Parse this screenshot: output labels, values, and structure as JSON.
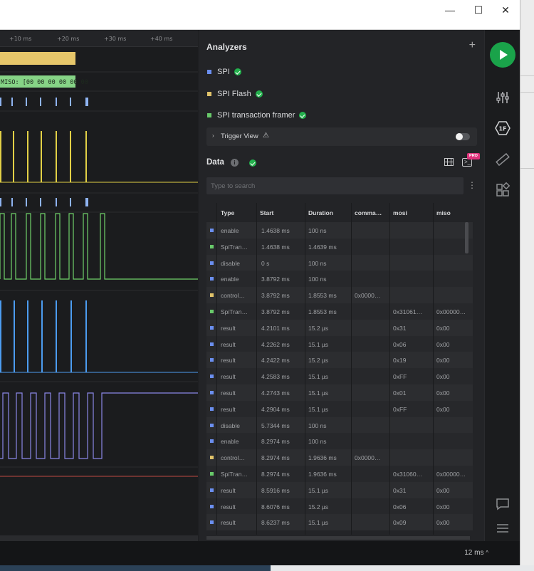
{
  "window": {
    "minimize_glyph": "—",
    "maximize_glyph": "☐",
    "close_glyph": "✕"
  },
  "timeline": {
    "ticks": [
      "+10 ms",
      "+20 ms",
      "+30 ms",
      "+40 ms"
    ]
  },
  "waveform": {
    "spi_decode_label": "MISO: [00 00 00 00 00 00",
    "channel_colors": [
      "#e6c66a",
      "#8fb4f2",
      "#e2d046",
      "#71d16a",
      "#4c9cf0",
      "#8a87e6",
      "#c24a43"
    ]
  },
  "analyzers": {
    "title": "Analyzers",
    "add_glyph": "+",
    "items": [
      {
        "label": "SPI",
        "color": "#6b8ff0"
      },
      {
        "label": "SPI Flash",
        "color": "#e0c36a"
      },
      {
        "label": "SPI transaction framer",
        "color": "#68c96a"
      }
    ],
    "trigger_view": {
      "label": "Trigger View",
      "warning_glyph": "⚠",
      "chevron": "›"
    }
  },
  "data_panel": {
    "title": "Data",
    "info_glyph": "i",
    "pro_badge": "PRO",
    "terminal_glyph": ">_",
    "search_placeholder": "Type to search",
    "menu_glyph": "⋮",
    "columns": [
      "Type",
      "Start",
      "Duration",
      "comma…",
      "mosi",
      "miso"
    ],
    "rows": [
      {
        "color": "#6b8ff0",
        "type": "enable",
        "start": "1.4638 ms",
        "duration": "100 ns",
        "command": "",
        "mosi": "",
        "miso": ""
      },
      {
        "color": "#68c96a",
        "type": "SpiTran…",
        "start": "1.4638 ms",
        "duration": "1.4639 ms",
        "command": "",
        "mosi": "",
        "miso": ""
      },
      {
        "color": "#6b8ff0",
        "type": "disable",
        "start": "0 s",
        "duration": "100 ns",
        "command": "",
        "mosi": "",
        "miso": ""
      },
      {
        "color": "#6b8ff0",
        "type": "enable",
        "start": "3.8792 ms",
        "duration": "100 ns",
        "command": "",
        "mosi": "",
        "miso": ""
      },
      {
        "color": "#e0c36a",
        "type": "control…",
        "start": "3.8792 ms",
        "duration": "1.8553 ms",
        "command": "0x0000…",
        "mosi": "",
        "miso": ""
      },
      {
        "color": "#68c96a",
        "type": "SpiTran…",
        "start": "3.8792 ms",
        "duration": "1.8553 ms",
        "command": "",
        "mosi": "0x31061…",
        "miso": "0x00000…"
      },
      {
        "color": "#6b8ff0",
        "type": "result",
        "start": "4.2101 ms",
        "duration": "15.2 µs",
        "command": "",
        "mosi": "0x31",
        "miso": "0x00"
      },
      {
        "color": "#6b8ff0",
        "type": "result",
        "start": "4.2262 ms",
        "duration": "15.1 µs",
        "command": "",
        "mosi": "0x06",
        "miso": "0x00"
      },
      {
        "color": "#6b8ff0",
        "type": "result",
        "start": "4.2422 ms",
        "duration": "15.2 µs",
        "command": "",
        "mosi": "0x19",
        "miso": "0x00"
      },
      {
        "color": "#6b8ff0",
        "type": "result",
        "start": "4.2583 ms",
        "duration": "15.1 µs",
        "command": "",
        "mosi": "0xFF",
        "miso": "0x00"
      },
      {
        "color": "#6b8ff0",
        "type": "result",
        "start": "4.2743 ms",
        "duration": "15.1 µs",
        "command": "",
        "mosi": "0x01",
        "miso": "0x00"
      },
      {
        "color": "#6b8ff0",
        "type": "result",
        "start": "4.2904 ms",
        "duration": "15.1 µs",
        "command": "",
        "mosi": "0xFF",
        "miso": "0x00"
      },
      {
        "color": "#6b8ff0",
        "type": "disable",
        "start": "5.7344 ms",
        "duration": "100 ns",
        "command": "",
        "mosi": "",
        "miso": ""
      },
      {
        "color": "#6b8ff0",
        "type": "enable",
        "start": "8.2974 ms",
        "duration": "100 ns",
        "command": "",
        "mosi": "",
        "miso": ""
      },
      {
        "color": "#e0c36a",
        "type": "control…",
        "start": "8.2974 ms",
        "duration": "1.9636 ms",
        "command": "0x0000…",
        "mosi": "",
        "miso": ""
      },
      {
        "color": "#68c96a",
        "type": "SpiTran…",
        "start": "8.2974 ms",
        "duration": "1.9636 ms",
        "command": "",
        "mosi": "0x31060…",
        "miso": "0x00000…"
      },
      {
        "color": "#6b8ff0",
        "type": "result",
        "start": "8.5916 ms",
        "duration": "15.1 µs",
        "command": "",
        "mosi": "0x31",
        "miso": "0x00"
      },
      {
        "color": "#6b8ff0",
        "type": "result",
        "start": "8.6076 ms",
        "duration": "15.2 µs",
        "command": "",
        "mosi": "0x06",
        "miso": "0x00"
      },
      {
        "color": "#6b8ff0",
        "type": "result",
        "start": "8.6237 ms",
        "duration": "15.1 µs",
        "command": "",
        "mosi": "0x09",
        "miso": "0x00"
      }
    ]
  },
  "toolbar": {
    "icons": [
      "play-icon",
      "sliders-icon",
      "hex-format-icon",
      "ruler-icon",
      "extensions-icon",
      "comment-icon",
      "menu-icon"
    ],
    "hex_label": "1F"
  },
  "status": {
    "zoom": "12 ms",
    "zoom_chevron": "^"
  }
}
